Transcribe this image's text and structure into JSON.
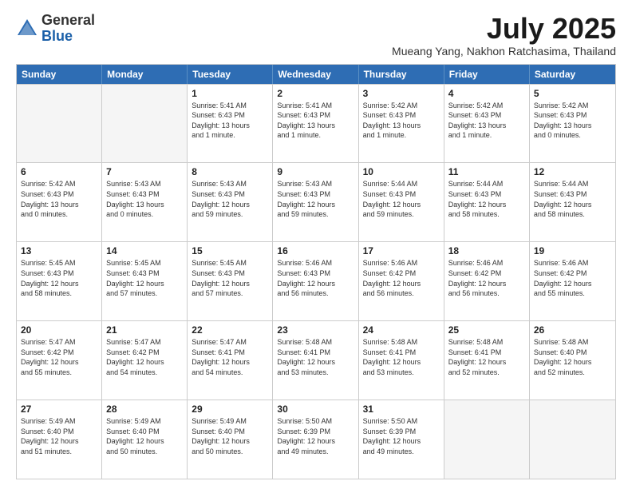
{
  "logo": {
    "general": "General",
    "blue": "Blue"
  },
  "header": {
    "month": "July 2025",
    "location": "Mueang Yang, Nakhon Ratchasima, Thailand"
  },
  "weekdays": [
    "Sunday",
    "Monday",
    "Tuesday",
    "Wednesday",
    "Thursday",
    "Friday",
    "Saturday"
  ],
  "weeks": [
    [
      {
        "day": "",
        "info": ""
      },
      {
        "day": "",
        "info": ""
      },
      {
        "day": "1",
        "info": "Sunrise: 5:41 AM\nSunset: 6:43 PM\nDaylight: 13 hours\nand 1 minute."
      },
      {
        "day": "2",
        "info": "Sunrise: 5:41 AM\nSunset: 6:43 PM\nDaylight: 13 hours\nand 1 minute."
      },
      {
        "day": "3",
        "info": "Sunrise: 5:42 AM\nSunset: 6:43 PM\nDaylight: 13 hours\nand 1 minute."
      },
      {
        "day": "4",
        "info": "Sunrise: 5:42 AM\nSunset: 6:43 PM\nDaylight: 13 hours\nand 1 minute."
      },
      {
        "day": "5",
        "info": "Sunrise: 5:42 AM\nSunset: 6:43 PM\nDaylight: 13 hours\nand 0 minutes."
      }
    ],
    [
      {
        "day": "6",
        "info": "Sunrise: 5:42 AM\nSunset: 6:43 PM\nDaylight: 13 hours\nand 0 minutes."
      },
      {
        "day": "7",
        "info": "Sunrise: 5:43 AM\nSunset: 6:43 PM\nDaylight: 13 hours\nand 0 minutes."
      },
      {
        "day": "8",
        "info": "Sunrise: 5:43 AM\nSunset: 6:43 PM\nDaylight: 12 hours\nand 59 minutes."
      },
      {
        "day": "9",
        "info": "Sunrise: 5:43 AM\nSunset: 6:43 PM\nDaylight: 12 hours\nand 59 minutes."
      },
      {
        "day": "10",
        "info": "Sunrise: 5:44 AM\nSunset: 6:43 PM\nDaylight: 12 hours\nand 59 minutes."
      },
      {
        "day": "11",
        "info": "Sunrise: 5:44 AM\nSunset: 6:43 PM\nDaylight: 12 hours\nand 58 minutes."
      },
      {
        "day": "12",
        "info": "Sunrise: 5:44 AM\nSunset: 6:43 PM\nDaylight: 12 hours\nand 58 minutes."
      }
    ],
    [
      {
        "day": "13",
        "info": "Sunrise: 5:45 AM\nSunset: 6:43 PM\nDaylight: 12 hours\nand 58 minutes."
      },
      {
        "day": "14",
        "info": "Sunrise: 5:45 AM\nSunset: 6:43 PM\nDaylight: 12 hours\nand 57 minutes."
      },
      {
        "day": "15",
        "info": "Sunrise: 5:45 AM\nSunset: 6:43 PM\nDaylight: 12 hours\nand 57 minutes."
      },
      {
        "day": "16",
        "info": "Sunrise: 5:46 AM\nSunset: 6:43 PM\nDaylight: 12 hours\nand 56 minutes."
      },
      {
        "day": "17",
        "info": "Sunrise: 5:46 AM\nSunset: 6:42 PM\nDaylight: 12 hours\nand 56 minutes."
      },
      {
        "day": "18",
        "info": "Sunrise: 5:46 AM\nSunset: 6:42 PM\nDaylight: 12 hours\nand 56 minutes."
      },
      {
        "day": "19",
        "info": "Sunrise: 5:46 AM\nSunset: 6:42 PM\nDaylight: 12 hours\nand 55 minutes."
      }
    ],
    [
      {
        "day": "20",
        "info": "Sunrise: 5:47 AM\nSunset: 6:42 PM\nDaylight: 12 hours\nand 55 minutes."
      },
      {
        "day": "21",
        "info": "Sunrise: 5:47 AM\nSunset: 6:42 PM\nDaylight: 12 hours\nand 54 minutes."
      },
      {
        "day": "22",
        "info": "Sunrise: 5:47 AM\nSunset: 6:41 PM\nDaylight: 12 hours\nand 54 minutes."
      },
      {
        "day": "23",
        "info": "Sunrise: 5:48 AM\nSunset: 6:41 PM\nDaylight: 12 hours\nand 53 minutes."
      },
      {
        "day": "24",
        "info": "Sunrise: 5:48 AM\nSunset: 6:41 PM\nDaylight: 12 hours\nand 53 minutes."
      },
      {
        "day": "25",
        "info": "Sunrise: 5:48 AM\nSunset: 6:41 PM\nDaylight: 12 hours\nand 52 minutes."
      },
      {
        "day": "26",
        "info": "Sunrise: 5:48 AM\nSunset: 6:40 PM\nDaylight: 12 hours\nand 52 minutes."
      }
    ],
    [
      {
        "day": "27",
        "info": "Sunrise: 5:49 AM\nSunset: 6:40 PM\nDaylight: 12 hours\nand 51 minutes."
      },
      {
        "day": "28",
        "info": "Sunrise: 5:49 AM\nSunset: 6:40 PM\nDaylight: 12 hours\nand 50 minutes."
      },
      {
        "day": "29",
        "info": "Sunrise: 5:49 AM\nSunset: 6:40 PM\nDaylight: 12 hours\nand 50 minutes."
      },
      {
        "day": "30",
        "info": "Sunrise: 5:50 AM\nSunset: 6:39 PM\nDaylight: 12 hours\nand 49 minutes."
      },
      {
        "day": "31",
        "info": "Sunrise: 5:50 AM\nSunset: 6:39 PM\nDaylight: 12 hours\nand 49 minutes."
      },
      {
        "day": "",
        "info": ""
      },
      {
        "day": "",
        "info": ""
      }
    ]
  ]
}
